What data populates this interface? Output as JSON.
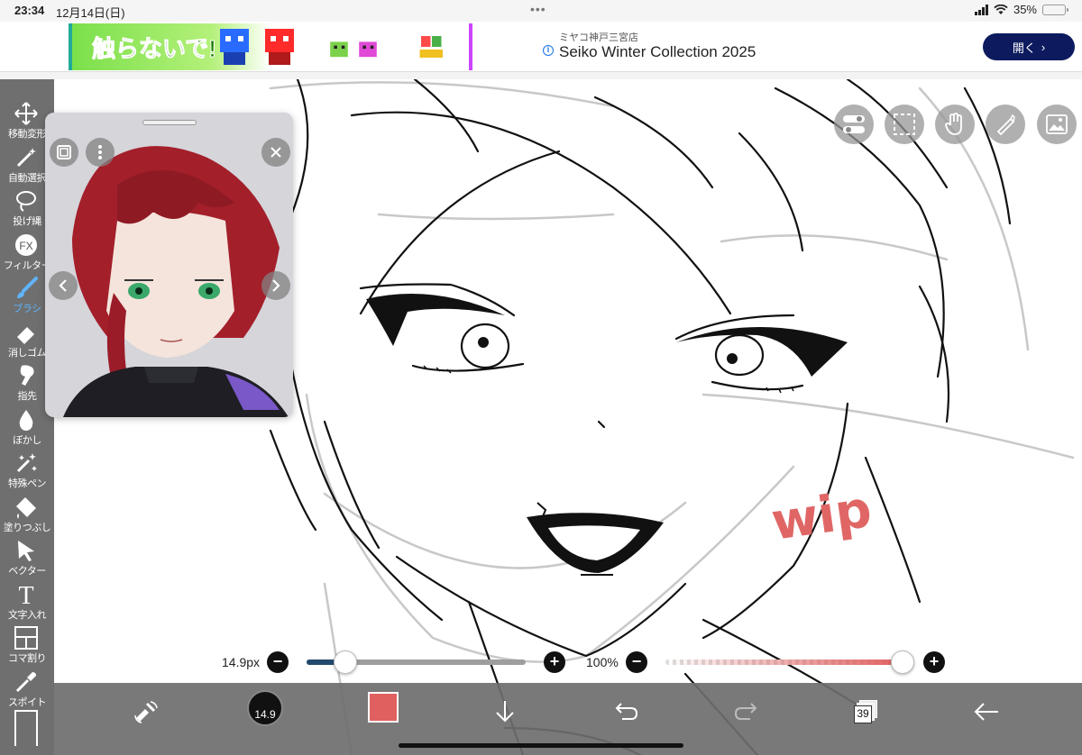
{
  "status_bar": {
    "time": "23:34",
    "date": "12月14日(日)",
    "dots": "•••",
    "battery_percent": "35%",
    "battery_level": 0.35,
    "wifi_icon": "wifi-icon"
  },
  "ad": {
    "image_text": "触らないで!",
    "store_name": "ミヤコ神戸三宮店",
    "headline": "Seiko Winter Collection 2025",
    "cta_label": "開く",
    "info_icon": "i",
    "cta_color": "#0d1b5e"
  },
  "toolbar": {
    "items": [
      {
        "label": "移動変形",
        "icon": "move-icon"
      },
      {
        "label": "自動選択",
        "icon": "magic-wand-icon"
      },
      {
        "label": "投げ縄",
        "icon": "lasso-icon"
      },
      {
        "label": "フィルター",
        "icon": "fx-icon",
        "glyph": "FX"
      },
      {
        "label": "ブラシ",
        "icon": "brush-icon"
      },
      {
        "label": "消しゴム",
        "icon": "eraser-icon"
      },
      {
        "label": "指先",
        "icon": "finger-icon"
      },
      {
        "label": "ぼかし",
        "icon": "blur-drop-icon"
      },
      {
        "label": "特殊ペン",
        "icon": "sparkle-pen-icon"
      },
      {
        "label": "塗りつぶし",
        "icon": "fill-bucket-icon"
      },
      {
        "label": "ベクター",
        "icon": "vector-arrow-icon"
      },
      {
        "label": "文字入れ",
        "icon": "text-icon",
        "glyph": "T"
      },
      {
        "label": "コマ割り",
        "icon": "panel-icon"
      },
      {
        "label": "スポイト",
        "icon": "eyedropper-icon"
      }
    ],
    "active": "ブラシ",
    "active_color": "#5fb5ff"
  },
  "canvas": {
    "annotation_text": "wip",
    "annotation_color": "#e06666"
  },
  "sliders": {
    "brush_size_label": "14.9px",
    "brush_size_value": 14.9,
    "opacity_label": "100%",
    "opacity_value": 1.0,
    "minus_glyph": "−",
    "plus_glyph": "+"
  },
  "bottom_bar": {
    "brush_size_display": "14.9",
    "current_color": "#e06060",
    "layer_count": "39"
  }
}
